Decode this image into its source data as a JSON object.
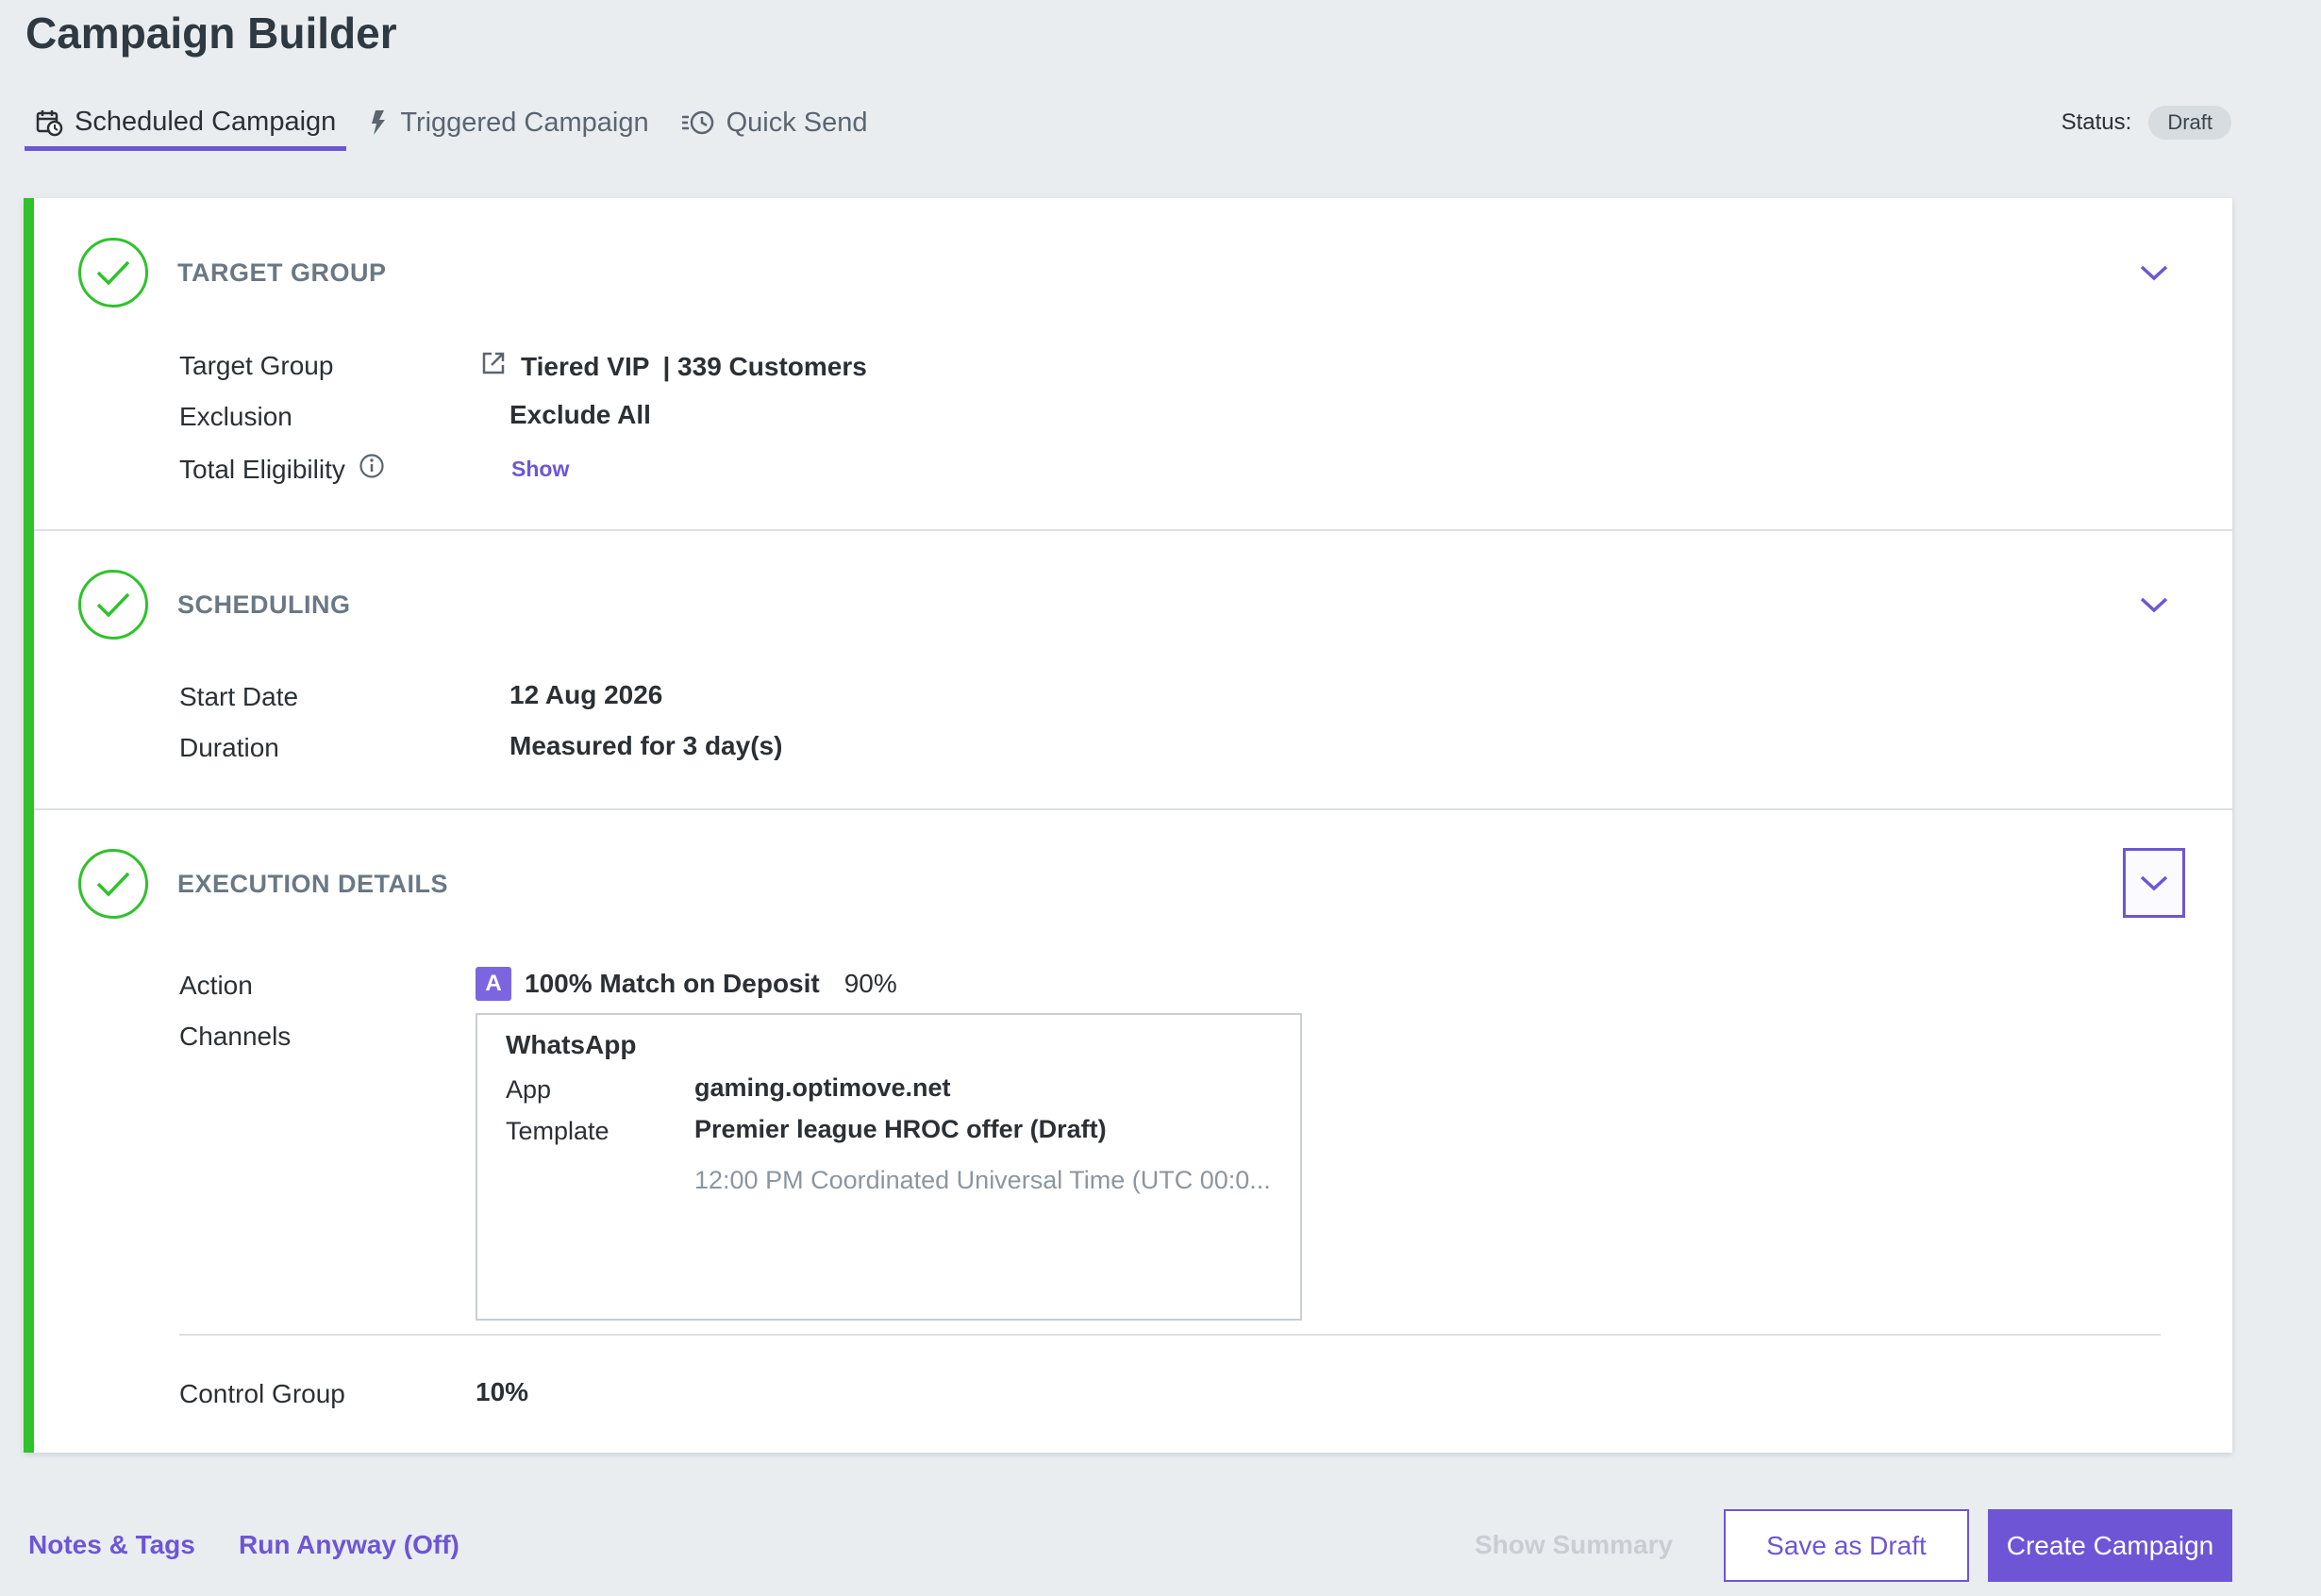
{
  "header": {
    "title": "Campaign Builder"
  },
  "tabs": [
    {
      "label": "Scheduled Campaign",
      "icon": "calendar-clock-icon",
      "active": true
    },
    {
      "label": "Triggered Campaign",
      "icon": "lightning-icon",
      "active": false
    },
    {
      "label": "Quick Send",
      "icon": "fast-clock-icon",
      "active": false
    }
  ],
  "status": {
    "label": "Status:",
    "value": "Draft"
  },
  "sections": {
    "target_group": {
      "title": "TARGET GROUP",
      "rows": {
        "target_group": {
          "label": "Target Group",
          "value": "Tiered VIP",
          "extra": "| 339 Customers"
        },
        "exclusion": {
          "label": "Exclusion",
          "value": "Exclude All"
        },
        "eligibility": {
          "label": "Total Eligibility",
          "value": "Show"
        }
      }
    },
    "scheduling": {
      "title": "SCHEDULING",
      "rows": {
        "start_date": {
          "label": "Start Date",
          "value": "12 Aug 2026"
        },
        "duration": {
          "label": "Duration",
          "value": "Measured for 3 day(s)"
        }
      }
    },
    "execution": {
      "title": "EXECUTION DETAILS",
      "action": {
        "label": "Action",
        "badge": "A",
        "value": "100% Match on Deposit",
        "percent": "90%"
      },
      "channels": {
        "label": "Channels",
        "name": "WhatsApp",
        "app_label": "App",
        "app_value": "gaming.optimove.net",
        "template_label": "Template",
        "template_value": "Premier league HROC offer (Draft)",
        "time": "12:00 PM Coordinated Universal Time (UTC 00:0..."
      },
      "control_group": {
        "label": "Control Group",
        "value": "10%"
      }
    }
  },
  "footer": {
    "notes_tags": "Notes & Tags",
    "run_anyway": "Run Anyway (Off)",
    "show_summary": "Show Summary",
    "save_draft": "Save as Draft",
    "create_campaign": "Create Campaign"
  },
  "colors": {
    "accent": "#6e55d6",
    "success": "#2fc22b",
    "background": "#e9edf0"
  }
}
